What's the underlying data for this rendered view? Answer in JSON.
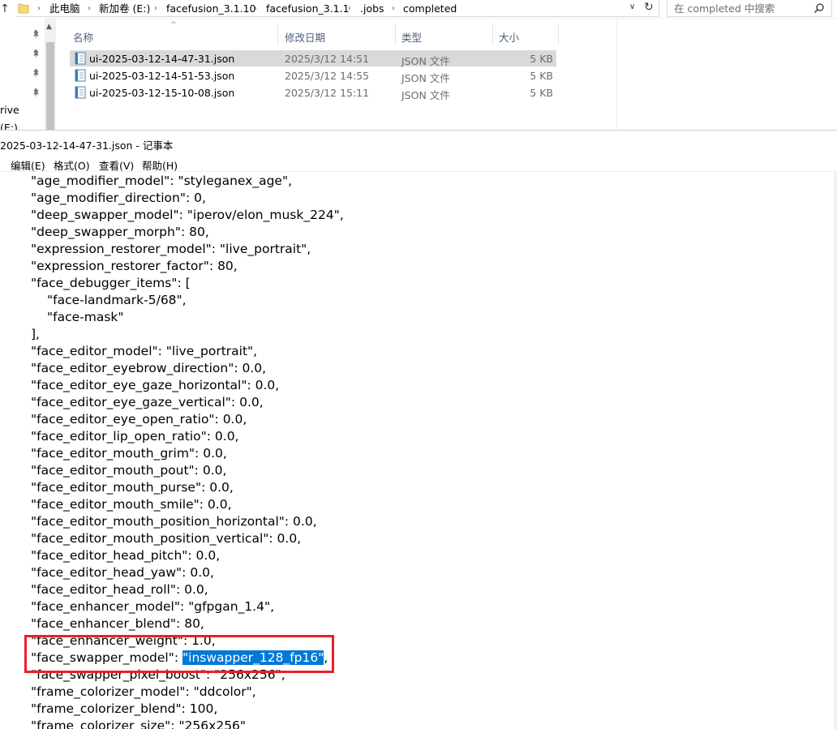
{
  "explorer": {
    "breadcrumbs": [
      "此电脑",
      "新加卷 (E:)",
      "facefusion_3.1.10",
      "facefusion_3.1.1",
      ".jobs",
      "completed"
    ],
    "search_placeholder": "在 completed 中搜索",
    "nav_labels": [
      "rive",
      "(E:)"
    ],
    "columns": {
      "name": "名称",
      "date": "修改日期",
      "type": "类型",
      "size": "大小"
    },
    "files": [
      {
        "name": "ui-2025-03-12-14-47-31.json",
        "date": "2025/3/12 14:51",
        "type": "JSON 文件",
        "size": "5 KB",
        "selected": true
      },
      {
        "name": "ui-2025-03-12-14-51-53.json",
        "date": "2025/3/12 14:55",
        "type": "JSON 文件",
        "size": "5 KB",
        "selected": false
      },
      {
        "name": "ui-2025-03-12-15-10-08.json",
        "date": "2025/3/12 15:11",
        "type": "JSON 文件",
        "size": "5 KB",
        "selected": false
      }
    ]
  },
  "notepad": {
    "title": "2025-03-12-14-47-31.json - 记事本",
    "menu": [
      "编辑(E)",
      "格式(O)",
      "查看(V)",
      "帮助(H)"
    ],
    "lines": [
      "\"age_modifier_model\": \"styleganex_age\",",
      "\"age_modifier_direction\": 0,",
      "\"deep_swapper_model\": \"iperov/elon_musk_224\",",
      "\"deep_swapper_morph\": 80,",
      "\"expression_restorer_model\": \"live_portrait\",",
      "\"expression_restorer_factor\": 80,",
      "\"face_debugger_items\": [",
      "\"face-landmark-5/68\",",
      "\"face-mask\"",
      "],",
      "\"face_editor_model\": \"live_portrait\",",
      "\"face_editor_eyebrow_direction\": 0.0,",
      "\"face_editor_eye_gaze_horizontal\": 0.0,",
      "\"face_editor_eye_gaze_vertical\": 0.0,",
      "\"face_editor_eye_open_ratio\": 0.0,",
      "\"face_editor_lip_open_ratio\": 0.0,",
      "\"face_editor_mouth_grim\": 0.0,",
      "\"face_editor_mouth_pout\": 0.0,",
      "\"face_editor_mouth_purse\": 0.0,",
      "\"face_editor_mouth_smile\": 0.0,",
      "\"face_editor_mouth_position_horizontal\": 0.0,",
      "\"face_editor_mouth_position_vertical\": 0.0,",
      "\"face_editor_head_pitch\": 0.0,",
      "\"face_editor_head_yaw\": 0.0,",
      "\"face_editor_head_roll\": 0.0,",
      "\"face_enhancer_model\": \"gfpgan_1.4\",",
      "\"face_enhancer_blend\": 80,",
      "\"face_enhancer_weight\": 1.0,",
      "\"face_swapper_model\": ",
      "\"face_swapper_pixel_boost\": \"256x256\",",
      "\"frame_colorizer_model\": \"ddcolor\",",
      "\"frame_colorizer_blend\": 100,",
      "\"frame_colorizer_size\": \"256x256\""
    ],
    "highlighted_value": "\"inswapper_128_fp16\"",
    "highlighted_suffix": ",",
    "indented_lines": [
      7,
      8
    ],
    "selection_color": "#0078d7",
    "annotation_color": "#e8202a"
  }
}
